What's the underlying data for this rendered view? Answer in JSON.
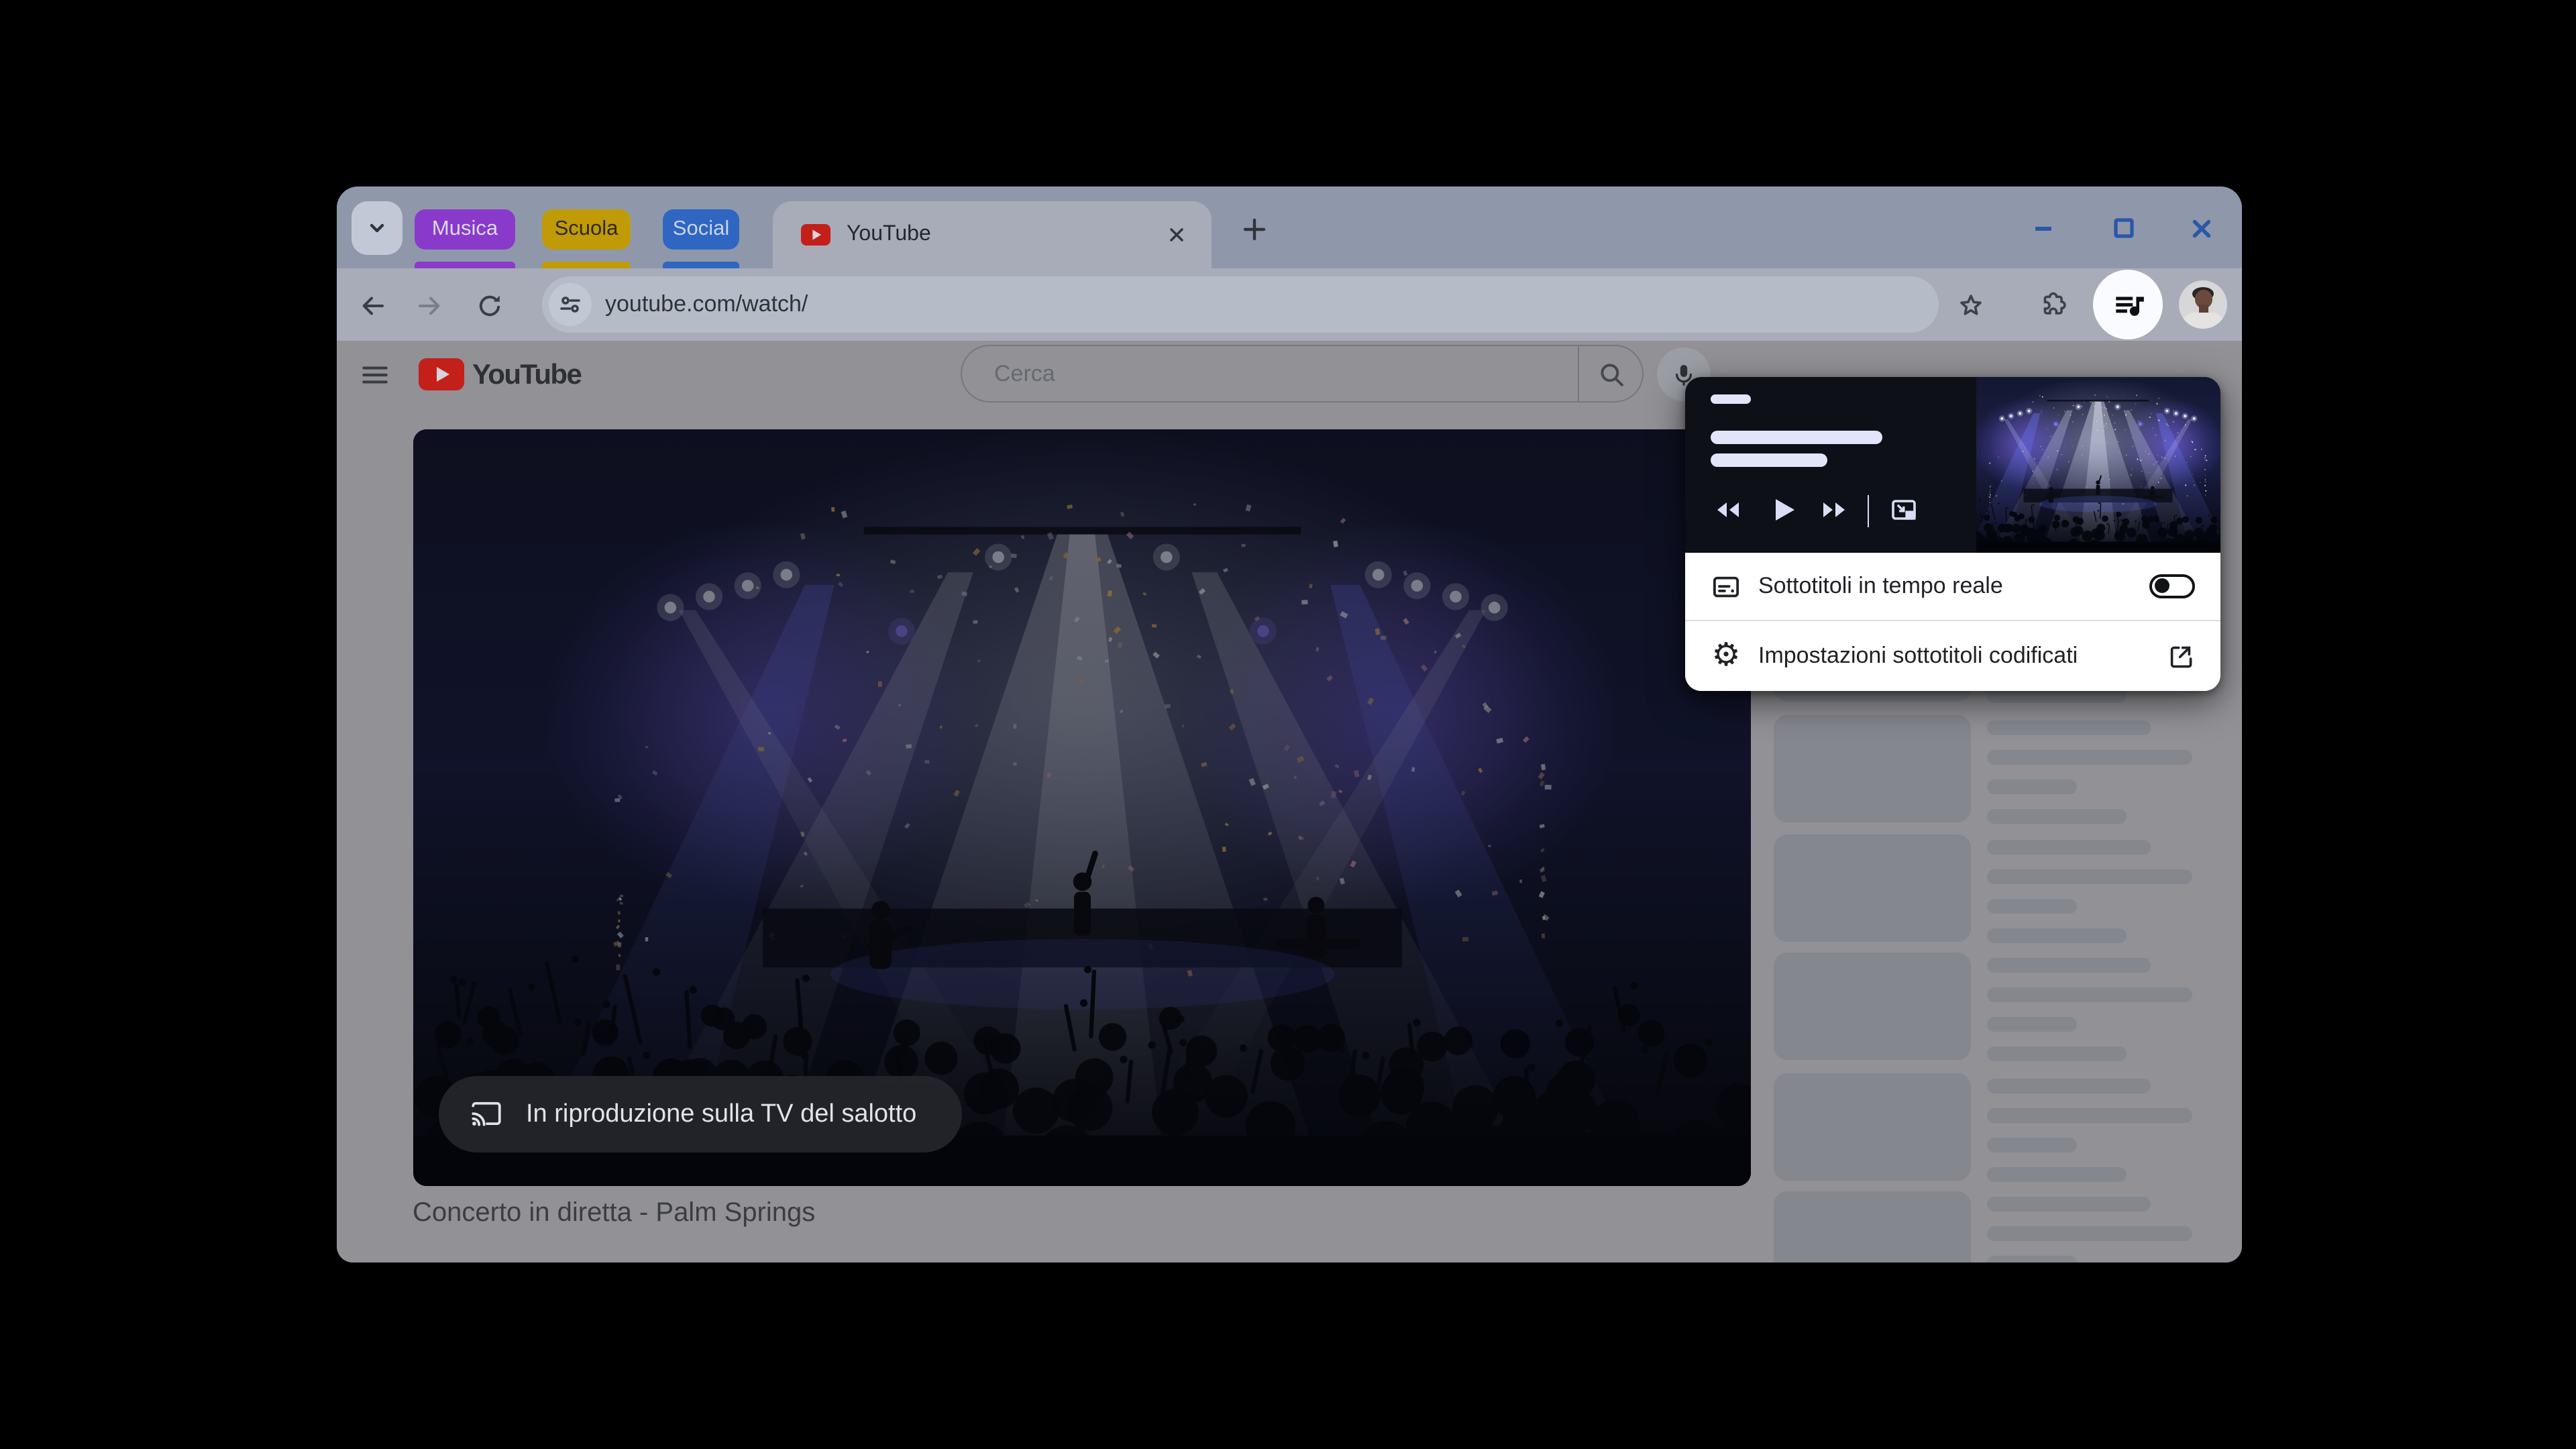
{
  "window": {
    "tab_strip": {
      "groups": [
        {
          "label": "Musica",
          "color": "#8A3ACB",
          "text_color": "#D8DBE6"
        },
        {
          "label": "Scuola",
          "color": "#C09B07",
          "text_color": "#2E2812"
        },
        {
          "label": "Social",
          "color": "#2F66C2",
          "text_color": "#CBD3E2"
        }
      ],
      "active_tab": {
        "title": "YouTube"
      }
    },
    "toolbar": {
      "url": "youtube.com/watch/"
    }
  },
  "page": {
    "header": {
      "brand": "YouTube",
      "search_placeholder": "Cerca"
    },
    "player": {
      "cast_banner": "In riproduzione sulla TV del salotto"
    },
    "video_title": "Concerto in diretta - Palm Springs"
  },
  "media_popup": {
    "rows": [
      {
        "label": "Sottotitoli in tempo reale",
        "toggle": "off"
      },
      {
        "label": "Impostazioni sottotitoli codificati",
        "action": "open-in-new"
      }
    ]
  },
  "icons": {
    "gear_glyph": "⚙"
  }
}
